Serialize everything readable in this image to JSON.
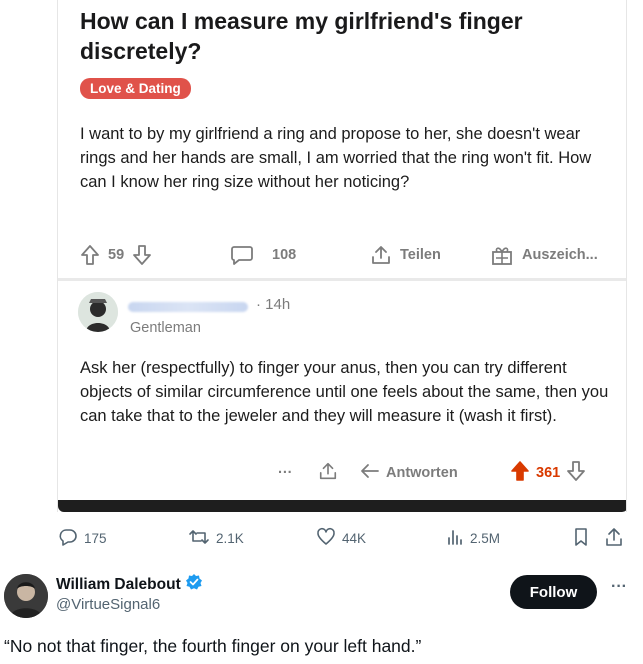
{
  "post": {
    "title": "How can I measure my girlfriend's finger discretely?",
    "tag": "Love & Dating",
    "body": "I want to by my girlfriend a ring and propose to her, she doesn't wear rings and her hands are small, I am worried that the ring won't fit. How can I know her ring size without her noticing?",
    "votes": "59",
    "comments": "108",
    "share_label": "Teilen",
    "award_label": "Auszeich..."
  },
  "comment": {
    "time": "· 14h",
    "flair": "Gentleman",
    "body": "Ask her (respectfully) to finger your anus, then you can try different objects of similar circumference until one feels about the same, then you can take that to the jeweler and they will measure it (wash it first).",
    "more_label": "···",
    "reply_label": "Antworten",
    "votes": "361"
  },
  "stats": {
    "replies": "175",
    "reposts": "2.1K",
    "likes": "44K",
    "views": "2.5M"
  },
  "author": {
    "name": "William Dalebout",
    "handle": "@VirtueSignal6",
    "follow_label": "Follow",
    "more_label": "···"
  },
  "tweet": {
    "text": "“No not that finger, the fourth finger on your left hand.”"
  },
  "colors": {
    "tag_bg": "#e0524a",
    "upvote_active": "#d93a00",
    "verified": "#1d9bf0",
    "follow_bg": "#0f1419"
  },
  "icons": [
    "upvote-icon",
    "downvote-icon",
    "comment-icon",
    "share-icon",
    "award-icon",
    "reply-icon",
    "repost-icon",
    "heart-icon",
    "views-icon",
    "bookmark-icon",
    "verified-badge-icon"
  ]
}
